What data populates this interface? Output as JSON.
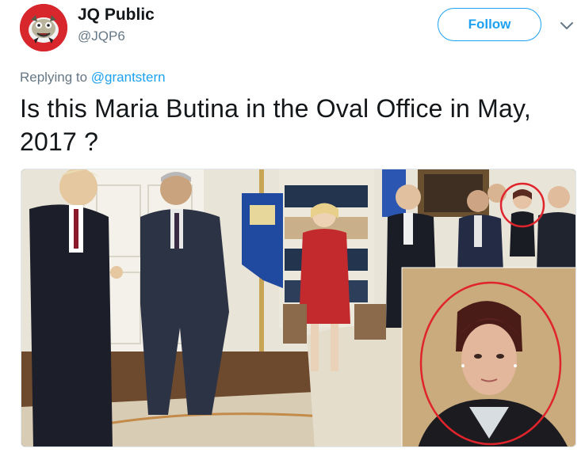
{
  "author": {
    "display_name": "JQ Public",
    "handle": "@JQP6",
    "avatar_icon": "cartoon-mascot-avatar"
  },
  "actions": {
    "follow_label": "Follow",
    "more_icon": "chevron-down-icon"
  },
  "reply": {
    "prefix": "Replying to ",
    "mention": "@grantstern"
  },
  "tweet": {
    "text": "Is this Maria Butina in the Oval Office in May, 2017 ?"
  },
  "media": {
    "type": "photo",
    "annotation_icon": "red-circle-highlight"
  },
  "colors": {
    "accent": "#1da1f2",
    "text": "#14171a",
    "muted": "#657786",
    "highlight": "#e0242c"
  }
}
